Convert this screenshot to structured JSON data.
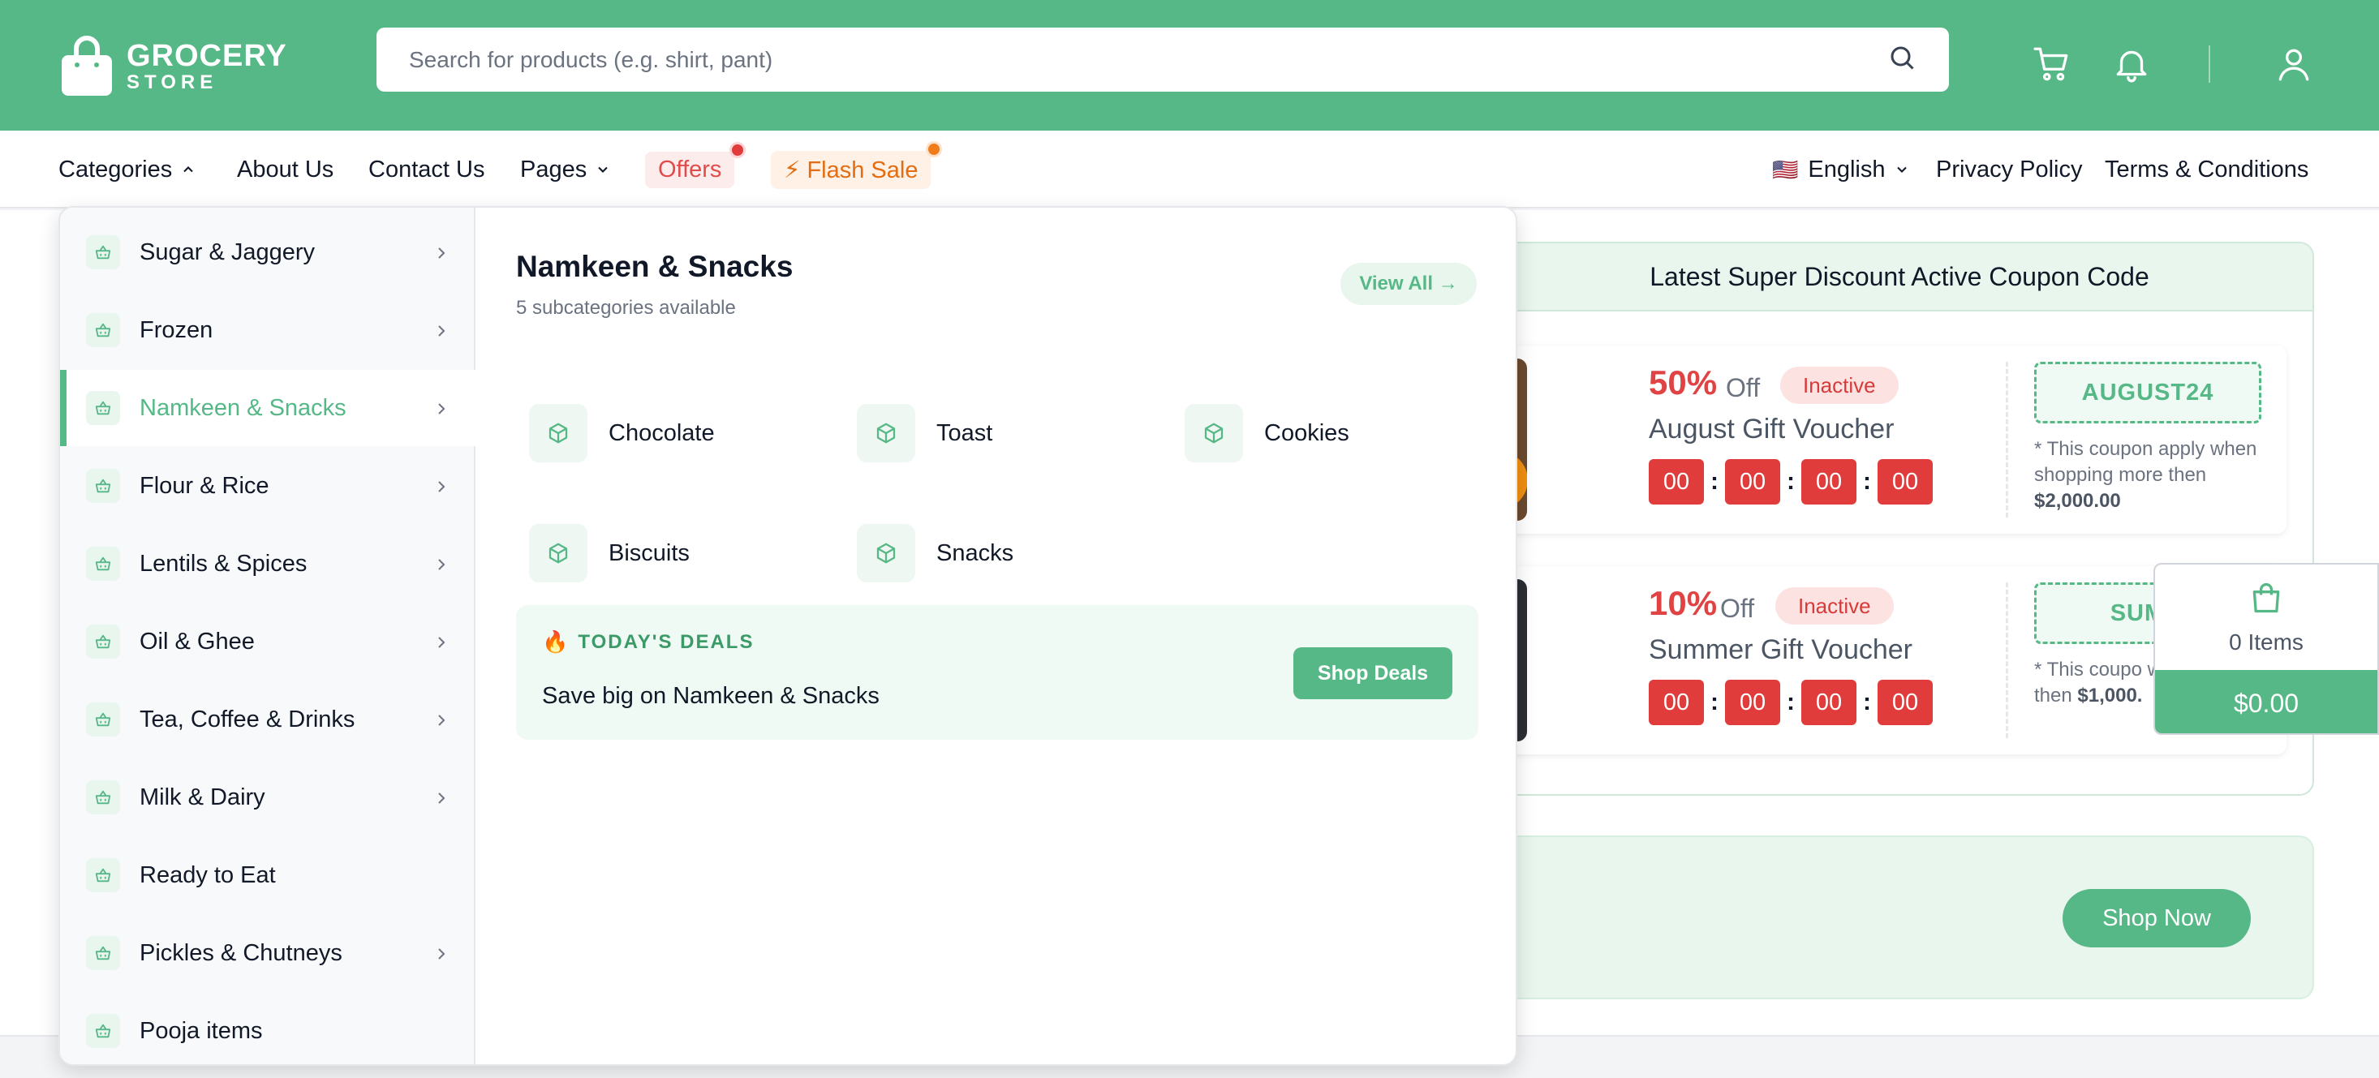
{
  "brand": {
    "title": "GROCERY",
    "subtitle": "STORE"
  },
  "search": {
    "placeholder": "Search for products (e.g. shirt, pant)"
  },
  "nav": {
    "categories": "Categories",
    "about": "About Us",
    "contact": "Contact Us",
    "pages": "Pages",
    "offers": "Offers",
    "flash_sale": "Flash Sale",
    "language_flag": "🇺🇸",
    "language": "English",
    "privacy": "Privacy Policy",
    "terms": "Terms & Conditions"
  },
  "categories": [
    {
      "label": "Sugar & Jaggery",
      "has_children": true
    },
    {
      "label": "Frozen",
      "has_children": true
    },
    {
      "label": "Namkeen & Snacks",
      "has_children": true,
      "active": true
    },
    {
      "label": "Flour & Rice",
      "has_children": true
    },
    {
      "label": "Lentils & Spices",
      "has_children": true
    },
    {
      "label": "Oil & Ghee",
      "has_children": true
    },
    {
      "label": "Tea, Coffee & Drinks",
      "has_children": true
    },
    {
      "label": "Milk & Dairy",
      "has_children": true
    },
    {
      "label": "Ready to Eat",
      "has_children": false
    },
    {
      "label": "Pickles & Chutneys",
      "has_children": true
    },
    {
      "label": "Pooja items",
      "has_children": false
    }
  ],
  "submenu": {
    "title": "Namkeen & Snacks",
    "count_text": "5 subcategories available",
    "view_all": "View All →",
    "items": [
      "Chocolate",
      "Toast",
      "Cookies",
      "Biscuits",
      "Snacks"
    ],
    "deals": {
      "icon": "🔥",
      "label": "TODAY'S DEALS",
      "text": "Save big on Namkeen & Snacks",
      "button": "Shop Deals"
    }
  },
  "coupons": {
    "heading": "Latest Super Discount Active Coupon Code",
    "list": [
      {
        "percent": "50%",
        "off": "Off",
        "status": "Inactive",
        "title": "August Gift Voucher",
        "timer": [
          "00",
          "00",
          "00",
          "00"
        ],
        "code": "AUGUST24",
        "note_prefix": "* This coupon apply when shopping more then ",
        "amount": "$2,000.00"
      },
      {
        "percent": "10%",
        "off": "Off",
        "status": "Inactive",
        "title": "Summer Gift Voucher",
        "timer": [
          "00",
          "00",
          "00",
          "00"
        ],
        "code": "SUMM",
        "note_prefix": "* This coupo when shoppi then ",
        "amount": "$1,000."
      }
    ]
  },
  "banner": {
    "button": "Shop Now"
  },
  "cart": {
    "count": "0 Items",
    "total": "$0.00"
  },
  "colors": {
    "brand_green": "#56b886",
    "danger_red": "#e03c3c",
    "flash_orange": "#e26d12"
  }
}
